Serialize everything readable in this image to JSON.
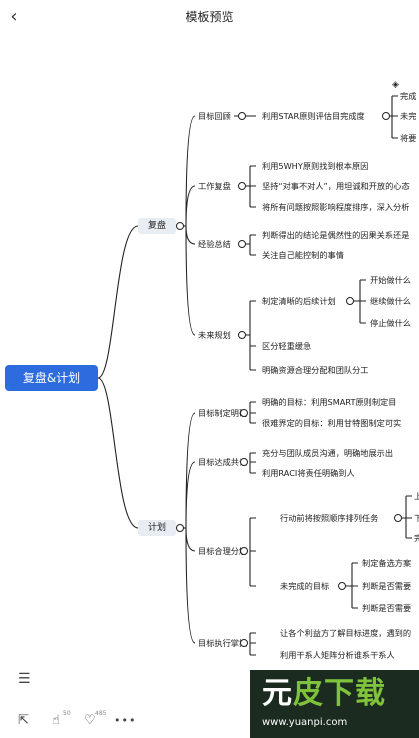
{
  "header": {
    "back_icon": "chevron-left-icon",
    "title": "模板预览"
  },
  "mindmap": {
    "root": "复盘&计划",
    "branches": [
      {
        "label": "复盘",
        "groups": [
          {
            "label": "目标回顾",
            "items": [
              "利用STAR原则评估目完成度"
            ],
            "subitems": [
              "完成",
              "未完",
              "将要"
            ]
          },
          {
            "label": "工作复盘",
            "items": [
              "利用5WHY原则找到根本原因",
              "坚持“对事不对人”，用坦诚和开放的心态",
              "将所有问题按照影响程度排序，深入分析"
            ]
          },
          {
            "label": "经验总结",
            "items": [
              "判断得出的结论是偶然性的因果关系还是",
              "关注自己能控制的事情"
            ]
          },
          {
            "label": "未来规划",
            "items": [
              "制定清晰的后续计划",
              "区分轻重缓急",
              "明确资源合理分配和团队分工"
            ],
            "subitems": [
              "开始做什么",
              "继续做什么",
              "停止做什么"
            ]
          }
        ]
      },
      {
        "label": "计划",
        "groups": [
          {
            "label": "目标制定明确",
            "items": [
              "明确的目标：利用SMART原则制定目",
              "很难界定的目标：利用甘特图制定可实"
            ]
          },
          {
            "label": "目标达成共识",
            "items": [
              "充分与团队成员沟通，明确地展示出",
              "利用RACI将责任明确到人"
            ]
          },
          {
            "label": "目标合理分解",
            "items": [
              "行动前将按照顺序排列任务",
              "未完成的目标"
            ],
            "subitems": [
              "上",
              "下",
              "完",
              "制定备选方案",
              "判断是否需要",
              "判断是否需要"
            ]
          },
          {
            "label": "目标执行掌控",
            "items": [
              "让各个利益方了解目标进度，遇到的",
              "利用干系人矩阵分析谁系干系人"
            ]
          }
        ]
      }
    ]
  },
  "toolbar": {
    "outline_icon": "outline-icon",
    "share_icon": "share-icon",
    "like_icon": "thumbs-up-icon",
    "like_count": "50",
    "fav_icon": "heart-icon",
    "fav_count": "485",
    "more_icon": "more-icon"
  },
  "watermark": {
    "text_a": "元",
    "text_b": "皮下载",
    "url": "www.yuanpi.com"
  }
}
